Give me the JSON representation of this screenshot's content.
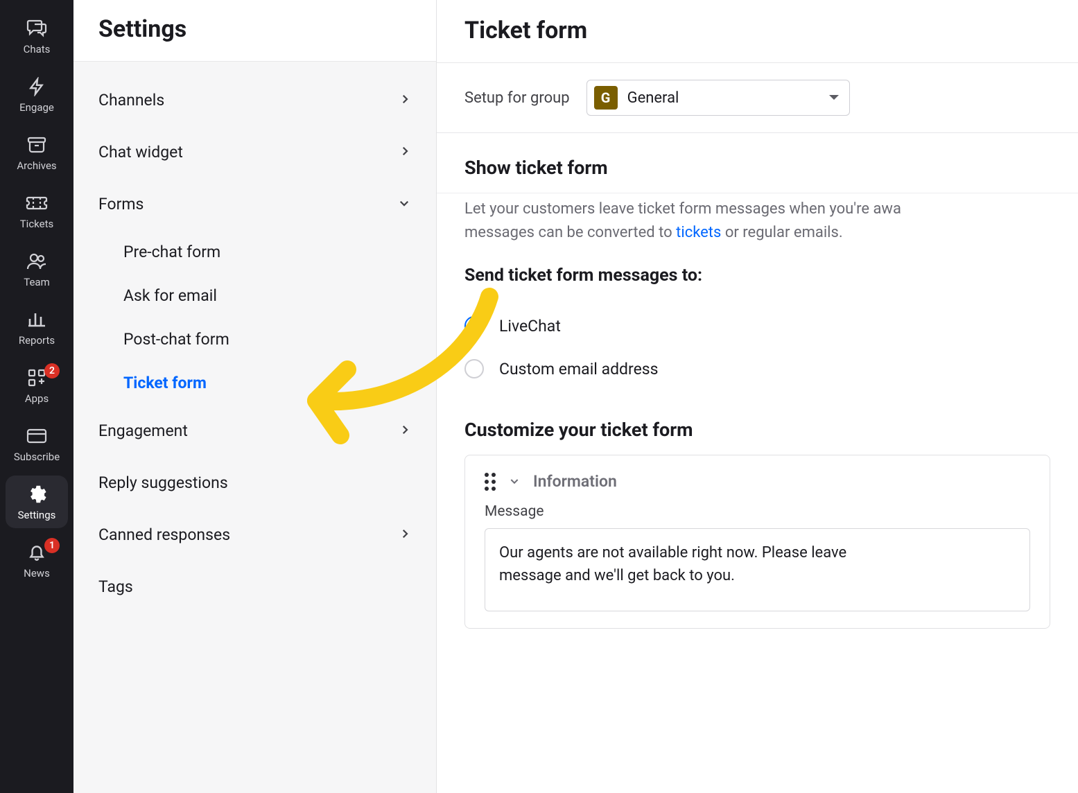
{
  "nav": {
    "items": [
      {
        "label": "Chats"
      },
      {
        "label": "Engage"
      },
      {
        "label": "Archives"
      },
      {
        "label": "Tickets"
      },
      {
        "label": "Team"
      },
      {
        "label": "Reports"
      },
      {
        "label": "Apps",
        "badge": "2"
      },
      {
        "label": "Subscribe"
      },
      {
        "label": "Settings",
        "active": true
      },
      {
        "label": "News",
        "badge": "1"
      }
    ]
  },
  "sidebar": {
    "title": "Settings",
    "menu": {
      "channels": "Channels",
      "chat_widget": "Chat widget",
      "forms": "Forms",
      "forms_items": {
        "pre_chat": "Pre-chat form",
        "ask_email": "Ask for email",
        "post_chat": "Post-chat form",
        "ticket_form": "Ticket form"
      },
      "engagement": "Engagement",
      "reply_suggestions": "Reply suggestions",
      "canned_responses": "Canned responses",
      "tags": "Tags"
    }
  },
  "main": {
    "title": "Ticket form",
    "group_label": "Setup for group",
    "group_chip": "G",
    "group_name": "General",
    "show_heading": "Show ticket form",
    "show_desc_pre": "Let your customers leave ticket form messages when you're awa",
    "show_desc_post_pre": "messages can be converted to ",
    "show_desc_link": "tickets",
    "show_desc_post_post": " or regular emails.",
    "send_heading": "Send ticket form messages to:",
    "radio_livechat": "LiveChat",
    "radio_custom": "Custom email address",
    "customize_heading": "Customize your ticket form",
    "card": {
      "title": "Information",
      "message_label": "Message",
      "message_value": "Our agents are not available right now. Please leave message and we'll get back to you."
    }
  }
}
